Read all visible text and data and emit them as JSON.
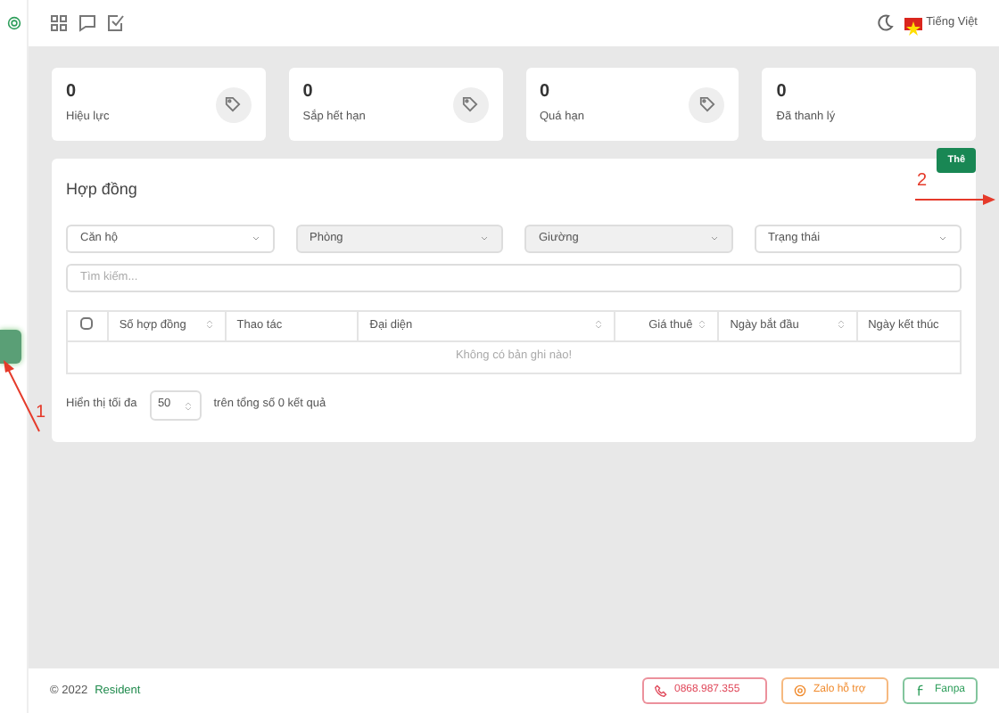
{
  "topbar": {
    "language": "Tiếng Việt"
  },
  "stats": [
    {
      "value": "0",
      "label": "Hiệu lực",
      "icon": true
    },
    {
      "value": "0",
      "label": "Sắp hết hạn",
      "icon": true
    },
    {
      "value": "0",
      "label": "Quá hạn",
      "icon": true
    },
    {
      "value": "0",
      "label": "Đã thanh lý",
      "icon": false
    }
  ],
  "add_button": "Thê",
  "contracts": {
    "title": "Hợp đồng",
    "filters": [
      {
        "label": "Căn hộ",
        "disabled": false
      },
      {
        "label": "Phòng",
        "disabled": true
      },
      {
        "label": "Giường",
        "disabled": true
      },
      {
        "label": "Trạng thái",
        "disabled": false
      }
    ],
    "search": {
      "placeholder": "Tìm kiếm..."
    },
    "table": {
      "select_all": {
        "checked": false
      },
      "columns": [
        {
          "label": "Số hợp đồng",
          "sortable": true
        },
        {
          "label": "Thao tác",
          "sortable": false
        },
        {
          "label": "Đại diện",
          "sortable": true
        },
        {
          "label": "Giá thuê",
          "sortable": true
        },
        {
          "label": "Ngày bắt đầu",
          "sortable": true
        },
        {
          "label": "Ngày kết thúc",
          "sortable": false
        }
      ],
      "empty": "Không có bản ghi nào!"
    },
    "paging": {
      "prefix": "Hiển thị tối đa",
      "page_size": "50",
      "suffix": "trên tổng số 0 kết quả"
    }
  },
  "footer": {
    "copyright": "© 2022",
    "brand": "Resident",
    "buttons": [
      {
        "kind": "phone",
        "label": "0868.987.355"
      },
      {
        "kind": "zalo",
        "label": "Zalo hỗ trợ"
      },
      {
        "kind": "fanpage",
        "label": "Fanpa"
      }
    ]
  },
  "annotations": [
    {
      "label": "1"
    },
    {
      "label": "2"
    }
  ]
}
